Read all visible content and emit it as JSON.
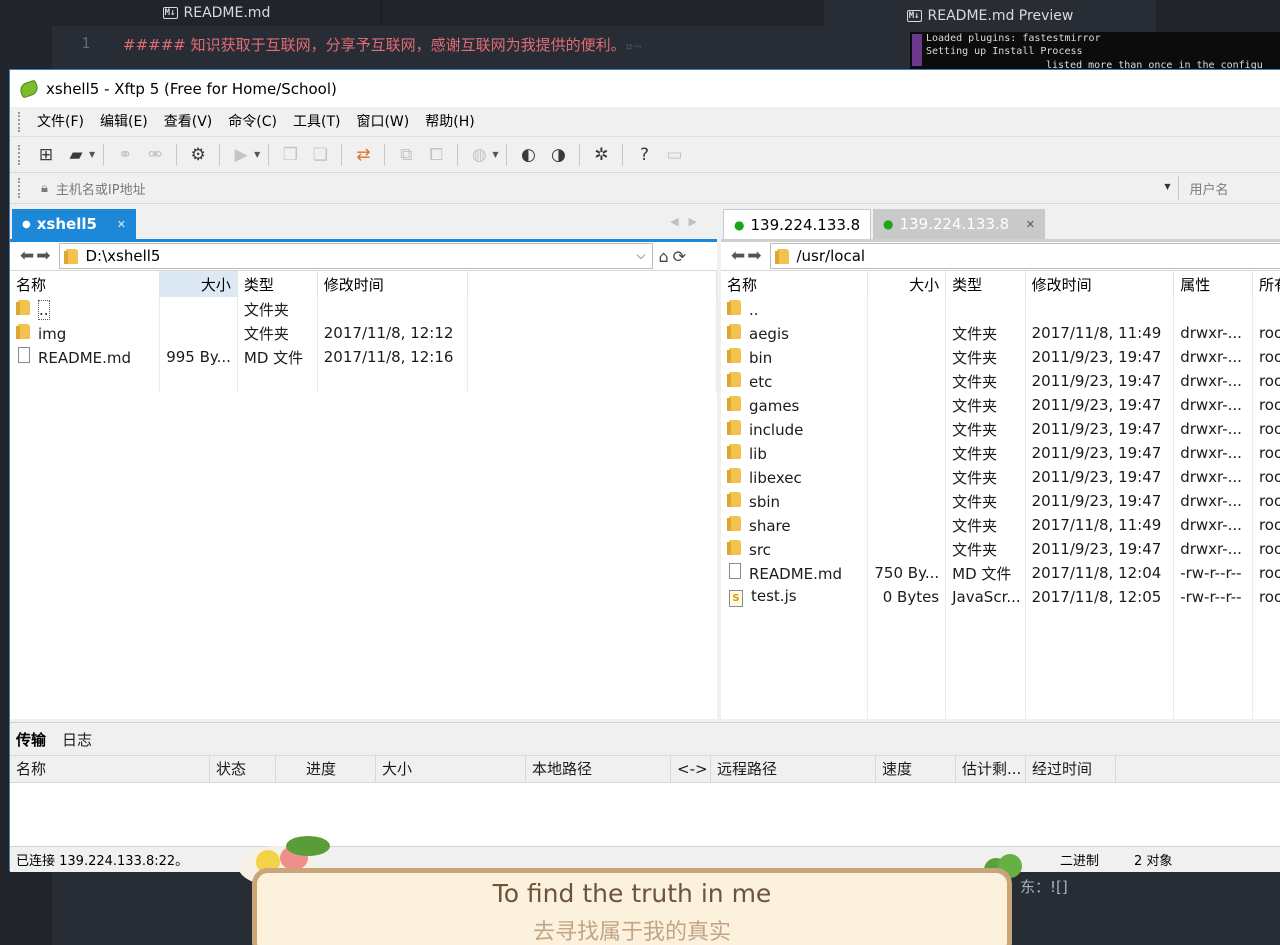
{
  "editor": {
    "left_tab_title": "README.md",
    "right_tab_title": "README.md Preview",
    "line_number": "1",
    "line_text": "##### 知识获取于互联网，分享予互联网，感谢互联网为我提供的便利。",
    "line_eol": "¤¬",
    "preview_tail": "东：![]",
    "terminal_lines": [
      "Loaded plugins: fastestmirror",
      "Setting up Install Process",
      "listed more than once in the configu"
    ]
  },
  "window": {
    "title": "xshell5 - Xftp 5 (Free for Home/School)"
  },
  "menu": [
    "文件(F)",
    "编辑(E)",
    "查看(V)",
    "命令(C)",
    "工具(T)",
    "窗口(W)",
    "帮助(H)"
  ],
  "address": {
    "host_placeholder": "主机名或IP地址",
    "user_placeholder": "用户名"
  },
  "left_pane": {
    "tab_label": "xshell5",
    "path": "D:\\xshell5",
    "columns": [
      "名称",
      "大小",
      "类型",
      "修改时间"
    ],
    "rows": [
      {
        "name": "..",
        "size": "",
        "type": "文件夹",
        "modified": "",
        "icon": "folder-icon"
      },
      {
        "name": "img",
        "size": "",
        "type": "文件夹",
        "modified": "2017/11/8, 12:12",
        "icon": "folder-icon"
      },
      {
        "name": "README.md",
        "size": "995 By...",
        "type": "MD 文件",
        "modified": "2017/11/8, 12:16",
        "icon": "file-icon"
      }
    ]
  },
  "right_pane": {
    "tab1_label": "139.224.133.8",
    "tab2_label": "139.224.133.8",
    "path": "/usr/local",
    "columns": [
      "名称",
      "大小",
      "类型",
      "修改时间",
      "属性",
      "所有"
    ],
    "rows": [
      {
        "name": "..",
        "size": "",
        "type": "",
        "modified": "",
        "attr": "",
        "owner": "",
        "icon": "folder-icon"
      },
      {
        "name": "aegis",
        "size": "",
        "type": "文件夹",
        "modified": "2017/11/8, 11:49",
        "attr": "drwxr-...",
        "owner": "roo",
        "icon": "folder-icon"
      },
      {
        "name": "bin",
        "size": "",
        "type": "文件夹",
        "modified": "2011/9/23, 19:47",
        "attr": "drwxr-...",
        "owner": "roo",
        "icon": "folder-icon"
      },
      {
        "name": "etc",
        "size": "",
        "type": "文件夹",
        "modified": "2011/9/23, 19:47",
        "attr": "drwxr-...",
        "owner": "roo",
        "icon": "folder-icon"
      },
      {
        "name": "games",
        "size": "",
        "type": "文件夹",
        "modified": "2011/9/23, 19:47",
        "attr": "drwxr-...",
        "owner": "roo",
        "icon": "folder-icon"
      },
      {
        "name": "include",
        "size": "",
        "type": "文件夹",
        "modified": "2011/9/23, 19:47",
        "attr": "drwxr-...",
        "owner": "roo",
        "icon": "folder-icon"
      },
      {
        "name": "lib",
        "size": "",
        "type": "文件夹",
        "modified": "2011/9/23, 19:47",
        "attr": "drwxr-...",
        "owner": "roo",
        "icon": "folder-icon"
      },
      {
        "name": "libexec",
        "size": "",
        "type": "文件夹",
        "modified": "2011/9/23, 19:47",
        "attr": "drwxr-...",
        "owner": "roo",
        "icon": "folder-icon"
      },
      {
        "name": "sbin",
        "size": "",
        "type": "文件夹",
        "modified": "2011/9/23, 19:47",
        "attr": "drwxr-...",
        "owner": "roo",
        "icon": "folder-icon"
      },
      {
        "name": "share",
        "size": "",
        "type": "文件夹",
        "modified": "2017/11/8, 11:49",
        "attr": "drwxr-...",
        "owner": "roo",
        "icon": "folder-icon"
      },
      {
        "name": "src",
        "size": "",
        "type": "文件夹",
        "modified": "2011/9/23, 19:47",
        "attr": "drwxr-...",
        "owner": "roo",
        "icon": "folder-icon"
      },
      {
        "name": "README.md",
        "size": "750 By...",
        "type": "MD 文件",
        "modified": "2017/11/8, 12:04",
        "attr": "-rw-r--r--",
        "owner": "roo",
        "icon": "file-icon"
      },
      {
        "name": "test.js",
        "size": "0 Bytes",
        "type": "JavaScr...",
        "modified": "2017/11/8, 12:05",
        "attr": "-rw-r--r--",
        "owner": "roo",
        "icon": "js-file-icon"
      }
    ]
  },
  "bottom": {
    "tabs": [
      "传输",
      "日志"
    ],
    "transfer_columns": [
      "名称",
      "状态",
      "进度",
      "大小",
      "本地路径",
      "<->",
      "远程路径",
      "速度",
      "估计剩...",
      "经过时间"
    ]
  },
  "status": {
    "connection": "已连接 139.224.133.8:22。",
    "mode": "二进制",
    "count": "2 对象"
  },
  "lyrics": {
    "english": "To find the truth in me",
    "chinese": "去寻找属于我的真实"
  },
  "colors": {
    "accent": "#1e88d8",
    "connected_dot": "#1aa51a",
    "editor_bg": "#282c34",
    "markdown_heading": "#e06c75"
  }
}
